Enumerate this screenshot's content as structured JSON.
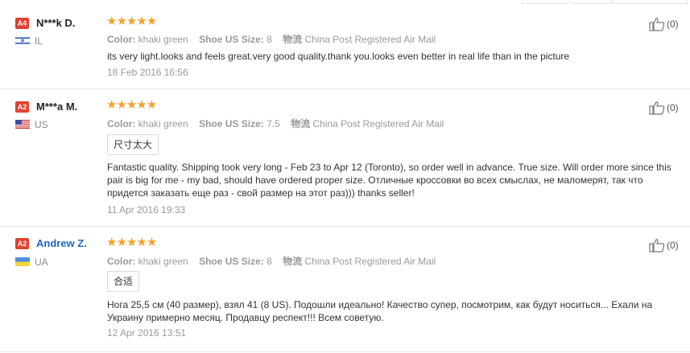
{
  "reviews": [
    {
      "badge": "A4",
      "name": "N***k D.",
      "country": "IL",
      "country_flag": "israel-flag",
      "rating": 5,
      "stars": "★★★★★",
      "color_label": "Color:",
      "color_value": "khaki green",
      "size_label": "Shoe US Size:",
      "size_value": "8",
      "logistics_label": "物流",
      "logistics_value": "China Post Registered Air Mail",
      "tag": "",
      "text": "its very light.looks and feels great.very good quality.thank you.looks even better in real life than in the picture",
      "date": "18 Feb 2016 16:56",
      "helpful": "(0)"
    },
    {
      "badge": "A2",
      "name": "M***a M.",
      "country": "US",
      "country_flag": "usa-flag",
      "rating": 5,
      "stars": "★★★★★",
      "color_label": "Color:",
      "color_value": "khaki green",
      "size_label": "Shoe US Size:",
      "size_value": "7.5",
      "logistics_label": "物流",
      "logistics_value": "China Post Registered Air Mail",
      "tag": "尺寸太大",
      "text": "Fantastic quality. Shipping took very long - Feb 23 to Apr 12 (Toronto), so order well in advance. True size. Will order more since this pair is big for me - my bad, should have ordered proper size. Отличные кроссовки во всех смыслах, не маломерят, так что придется заказать еще раз - свой размер на этот раз))) thanks seller!",
      "date": "11 Apr 2016 19:33",
      "helpful": "(0)"
    },
    {
      "badge": "A2",
      "name": "Andrew Z.",
      "country": "UA",
      "country_flag": "ukraine-flag",
      "rating": 5,
      "stars": "★★★★★",
      "color_label": "Color:",
      "color_value": "khaki green",
      "size_label": "Shoe US Size:",
      "size_value": "8",
      "logistics_label": "物流",
      "logistics_value": "China Post Registered Air Mail",
      "tag": "合适",
      "text": "Нога 25,5 см (40 размер), взял 41 (8 US). Подошли идеально! Качество супер, посмотрим, как будут носиться... Ехали на Украину примерно месяц. Продавцу респект!!! Всем советую.",
      "date": "12 Apr 2016 13:51",
      "helpful": "(0)"
    }
  ],
  "colors": {
    "badge": "#e0412e",
    "star": "#f5a12a",
    "link": "#1a66c2",
    "muted": "#999999"
  }
}
